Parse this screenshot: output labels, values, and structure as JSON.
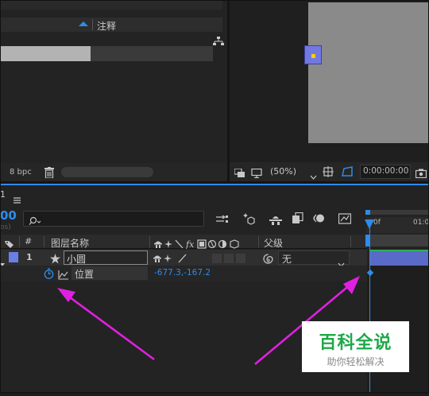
{
  "project_panel": {
    "comment_header": "注释",
    "bpc_label": "8 bpc"
  },
  "composition_viewer": {
    "zoom": "(50%)",
    "timecode": "0:00:00:00"
  },
  "timeline": {
    "tab_number": "1",
    "current_time_partial": "00",
    "current_time_sub": "os)",
    "search_placeholder": "",
    "columns": {
      "number": "#",
      "layer_name": "图层名称",
      "parent": "父级"
    },
    "layer": {
      "index": "1",
      "name": "小圆",
      "parent_value": "无"
    },
    "property": {
      "name": "位置",
      "value": "-677.3,-167.2"
    },
    "ruler": {
      "start_label": "0f",
      "second_label": "01:0"
    }
  },
  "watermark": {
    "title": "百科全说",
    "subtitle": "助你轻松解决"
  },
  "colors": {
    "accent_blue": "#2d8ceb",
    "layer_label": "#6a7ee8",
    "layer_bar": "#5a6ac8",
    "arrow_magenta": "#e020e0",
    "watermark_green": "#1fa84a"
  }
}
